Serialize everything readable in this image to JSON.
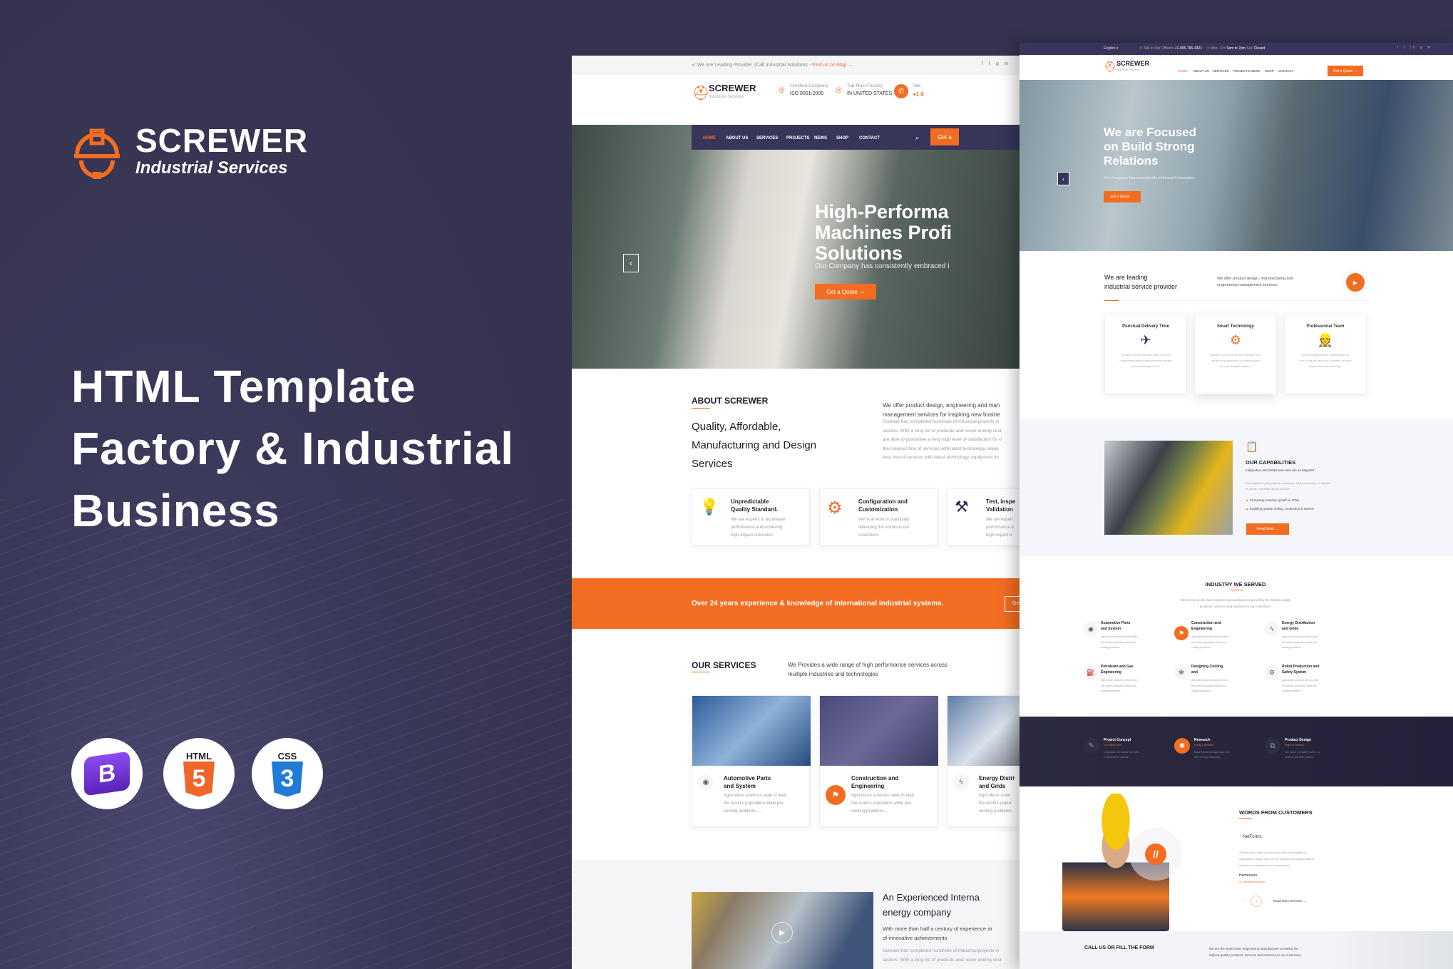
{
  "promo": {
    "brand": "SCREWER",
    "tagline": "Industrial Services",
    "headline": [
      "HTML Template",
      "Factory & Industrial",
      "Business"
    ],
    "badges": [
      {
        "name": "bootstrap",
        "label": "B"
      },
      {
        "name": "html5",
        "label": "HTML",
        "glyph": "5"
      },
      {
        "name": "css3",
        "label": "CSS",
        "glyph": "3"
      }
    ],
    "colors": {
      "background": "#35334f",
      "accent": "#f26d21",
      "nav": "#37355a"
    }
  },
  "home1": {
    "topbar": {
      "text": "We are Leading Provider of all Industrial Solutions - ",
      "link": "Find us on Map →",
      "social": [
        "f",
        "t",
        "g",
        "in"
      ]
    },
    "logo": {
      "name": "SCREWER",
      "tagline": "Industrial Services"
    },
    "info": [
      {
        "label": "Certified Company",
        "value": "ISO 9001:2005"
      },
      {
        "label": "Top Most Factory",
        "value": "IN UNITED STATES"
      },
      {
        "label": "Talk",
        "value": "+1 0"
      }
    ],
    "nav": [
      "HOME",
      "ABOUT US",
      "SERVICES",
      "PROJECTS",
      "NEWS",
      "SHOP",
      "CONTACT"
    ],
    "nav_button": "Get a",
    "hero": {
      "title": [
        "High-Performa",
        "Machines Profi",
        "Solutions"
      ],
      "text": "Our Company has consistently embraced i",
      "button": "Get a Quote →"
    },
    "about": {
      "label": "ABOUT SCREWER",
      "heading": [
        "Quality, Affordable,",
        "Manufacturing and Design",
        "Services"
      ],
      "lead": [
        "We offer product design, engineering and man",
        "management services for inspiring new busine"
      ],
      "body": [
        "Screwer has completed hundreds of industrial projects in",
        "sectors. With a long list of products and never ending cust",
        "are able to guarantee a very high level of satisfaction for o",
        "the cleanest line of services with latest technology, equip",
        "best line of services with latest technology, equipment lin"
      ],
      "features": [
        {
          "title": [
            "Unpredictable",
            "Quality Standard."
          ],
          "text": [
            "We are experts in accelerate",
            "performance and achieving",
            "high-impact outcomes."
          ]
        },
        {
          "title": [
            "Configuration and",
            "Customization"
          ],
          "text": [
            "We're at work in practically",
            "delivering the solutions our",
            "customers."
          ]
        },
        {
          "title": [
            "Test, inspe",
            "Validation"
          ],
          "text": [
            "We are expert",
            "performance a",
            "high-impact o"
          ]
        }
      ]
    },
    "banner": {
      "text": "Over 24 years experience & knowledge of international industrial systems.",
      "button": "Ge"
    },
    "services": {
      "label": "OUR SERVICES",
      "intro": [
        "We Provides a wide range of high performance services across",
        "multiple industries and technologies"
      ],
      "cards": [
        {
          "title": [
            "Automotive Parts",
            "and System"
          ],
          "text": [
            "Agriculture sciences seek to feed",
            "the world's population while pre-",
            "venting problems ..."
          ]
        },
        {
          "title": [
            "Construction and",
            "Engineering"
          ],
          "text": [
            "Agriculture sciences seek to feed",
            "the world's population while pre-",
            "venting problems ..."
          ]
        },
        {
          "title": [
            "Energy Distri",
            "and Grids"
          ],
          "text": [
            "Agriculture scien",
            "the world's popul",
            "venting problems"
          ]
        }
      ]
    },
    "experience": {
      "heading": [
        "An Experienced Interna",
        "energy company"
      ],
      "lead": [
        "With more than half a century of experience ar",
        "of innovative achievements"
      ],
      "body": [
        "Screwer has completed hundreds of industrial projects in",
        "sectors. With a long list of products and never ending cust"
      ]
    }
  },
  "home2": {
    "topbar": {
      "language": "English",
      "phone_label": "Talk to Our Officers",
      "phone": "+1-005-765-4321",
      "hours_label": "Mon - Fri:",
      "hours": "9am to 7pm",
      "closed_label": "Sat:",
      "closed": "Closed"
    },
    "logo": {
      "name": "SCREWER",
      "tagline": "Industrial Services"
    },
    "nav": [
      "HOME",
      "ABOUT US",
      "SERVICES",
      "PROJECTS",
      "NEWS",
      "SHOP",
      "CONTACT"
    ],
    "nav_button": "Get a Quote →",
    "hero": {
      "title": [
        "We are Focused",
        "on Build Strong",
        "Relations"
      ],
      "text": "Our Company has consistently embraced innovation.",
      "button": "Get a Quote →"
    },
    "leading": {
      "heading": [
        "We are leading",
        "industrial service provider"
      ],
      "text": [
        "We offer product design, manufacturing and",
        "engineering management services."
      ],
      "cards": [
        {
          "title": "Punctual Delivery Time",
          "text": [
            "To take a trivial example, which us ever",
            "undertakes labori physical exercis except",
            "some advantage from it."
          ]
        },
        {
          "title": "Smart Technology",
          "text": [
            "Explain to you how all this mistaken idea",
            "denouncing pleasure our praising pain",
            "born & complete system."
          ]
        },
        {
          "title": "Professional Team",
          "text": [
            "Denouncing pleasure praising pain all",
            "born & we will give you complete account",
            "expound actual teachings."
          ]
        }
      ]
    },
    "capabilities": {
      "title": "OUR CAPABILITIES",
      "lead": "Indignation and dislike men who are so beguiled.",
      "body": [
        "Demoralized by the charms of pleasure off that moment, so blinded",
        "by desire, that they cannot foresee."
      ],
      "bullets": [
        "Increasing revenue growth in 2016.",
        "Enabling greater selling, production & service"
      ],
      "button": "Read More →"
    },
    "industry": {
      "title": "INDUSTRY WE SERVED",
      "intro": [
        "We are the world class engineering manufacturer providing the highest quality",
        "products, services and solutions to our customers."
      ],
      "items": [
        {
          "title": [
            "Automotive Parts",
            "and System"
          ]
        },
        {
          "title": [
            "Construction and",
            "Engineering"
          ]
        },
        {
          "title": [
            "Energy Distribution",
            "and Grids"
          ]
        },
        {
          "title": [
            "Petroleum and Gas",
            "Engineering"
          ]
        },
        {
          "title": [
            "Designing Cooling",
            "and"
          ]
        },
        {
          "title": [
            "Robot Production and",
            "Safety System"
          ]
        }
      ],
      "item_text": [
        "Agriculture sciences seek to feed",
        "the world's population while pre-",
        "venting problems ..."
      ]
    },
    "process": [
      {
        "title": "Project Concept",
        "sub": "Your Basic Idea",
        "text": [
          "Indignation and dislike men who",
          "a demoralized charms."
        ]
      },
      {
        "title": "Research",
        "sub": "Firstly & Demand",
        "text": [
          "Equal blame belongs those who",
          "their through weakness."
        ]
      },
      {
        "title": "Product Design",
        "sub": "Begin to Develop",
        "text": [
          "Our power of choice is when do",
          "what we like best present."
        ]
      }
    ],
    "testimonial": {
      "title": "WORDS FROM CUSTOMERS",
      "company": "NetFortris",
      "quote": [
        "On the other hand, we denounce with work righteous",
        "indignations dislike men we are beguiled demoralize that all",
        "charms our moments is to be welcomed."
      ],
      "name": "Harmission",
      "role": "Sr. Software Developer",
      "more": "Read More Reviews →"
    },
    "contact": {
      "title": "CALL US OR FILL THE FORM",
      "text": [
        "We are the world class engineering manufacturer providing the",
        "highest quality products, services and solutions to our customers."
      ]
    }
  }
}
